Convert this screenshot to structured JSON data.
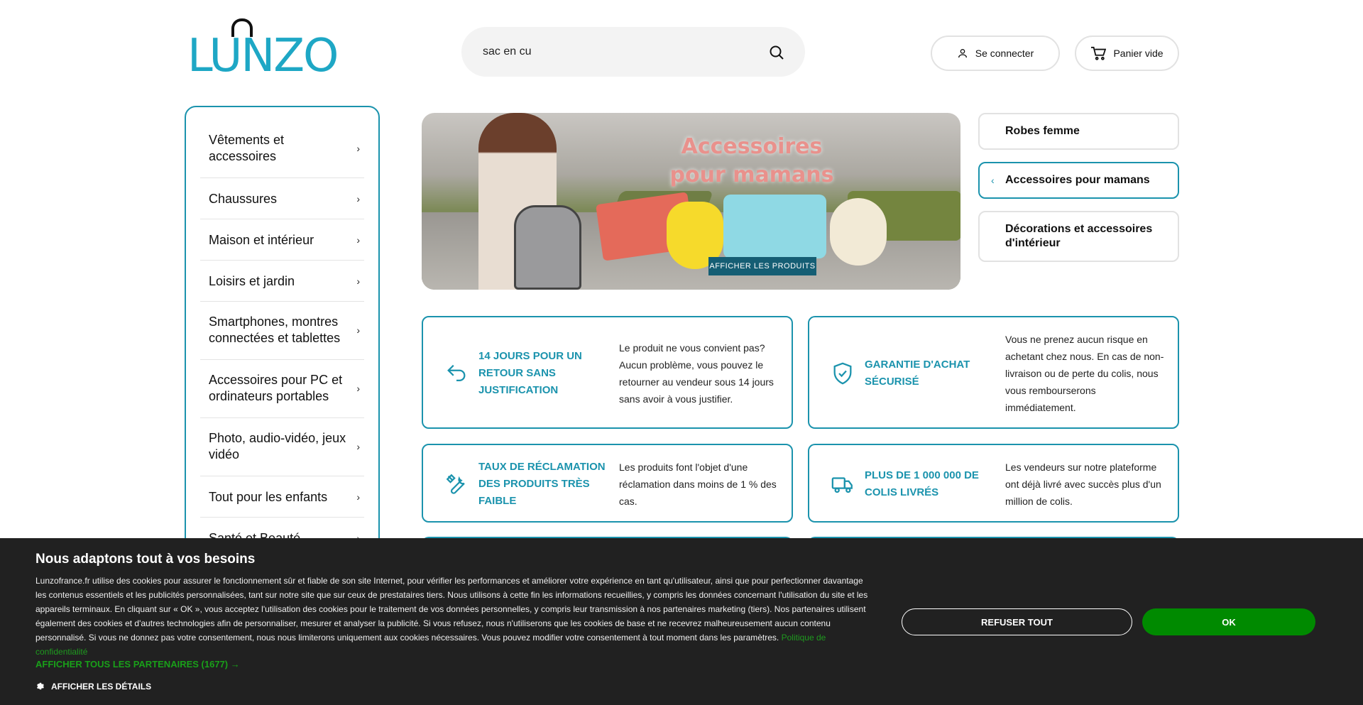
{
  "header": {
    "logo_text": "LUNZO",
    "search_value": "sac en cu",
    "login_label": "Se connecter",
    "cart_label": "Panier vide"
  },
  "sidebar": {
    "items": [
      {
        "label": "Vêtements et accessoires"
      },
      {
        "label": "Chaussures"
      },
      {
        "label": "Maison et intérieur"
      },
      {
        "label": "Loisirs et jardin"
      },
      {
        "label": "Smartphones, montres connectées et tablettes"
      },
      {
        "label": "Accessoires pour PC et ordinateurs portables"
      },
      {
        "label": "Photo, audio-vidéo, jeux vidéo"
      },
      {
        "label": "Tout pour les enfants"
      },
      {
        "label": "Santé et Beauté"
      }
    ]
  },
  "banner": {
    "title": "Accessoires pour mamans",
    "button_label": "AFFICHER LES PRODUITS"
  },
  "categories": [
    {
      "label": "Robes femme"
    },
    {
      "label": "Accessoires pour mamans",
      "active": true
    },
    {
      "label": "Décorations et accessoires d'intérieur"
    }
  ],
  "cards": [
    {
      "icon": "return-arrow-icon",
      "title": "14 JOURS POUR UN RETOUR SANS JUSTIFICATION",
      "text": "Le produit ne vous convient pas? Aucun problème, vous pouvez le retourner au vendeur sous 14 jours sans avoir à vous justifier."
    },
    {
      "icon": "shield-check-icon",
      "title": "GARANTIE D'ACHAT SÉCURISÉ",
      "text": "Vous ne prenez aucun risque en achetant chez nous. En cas de non-livraison ou de perte du colis, nous vous rembourserons immédiatement."
    },
    {
      "icon": "tools-icon",
      "title": "TAUX DE RÉCLAMATION DES PRODUITS TRÈS FAIBLE",
      "text": "Les produits font l'objet d'une réclamation dans moins de 1 % des cas."
    },
    {
      "icon": "truck-icon",
      "title": "PLUS DE 1 000 000 DE COLIS LIVRÉS",
      "text": "Les vendeurs sur notre plateforme ont déjà livré avec succès plus d'un million de colis."
    }
  ],
  "cookie": {
    "title": "Nous adaptons tout à vos besoins",
    "text": "Lunzofrance.fr utilise des cookies pour assurer le fonctionnement sûr et fiable de son site Internet, pour vérifier les performances et améliorer votre expérience en tant qu'utilisateur, ainsi que pour perfectionner davantage les contenus essentiels et les publicités personnalisées, tant sur notre site que sur ceux de prestataires tiers. Nous utilisons à cette fin les informations recueillies, y compris les données concernant l'utilisation du site et les appareils terminaux. En cliquant sur « OK », vous acceptez l'utilisation des cookies pour le traitement de vos données personnelles, y compris leur transmission à nos partenaires marketing (tiers). Nos partenaires utilisent également des cookies et d'autres technologies afin de personnaliser, mesurer et analyser la publicité. Si vous refusez, nous n'utiliserons que les cookies de base et ne recevrez malheureusement aucun contenu personnalisé. Si vous ne donnez pas votre consentement, nous nous limiterons uniquement aux cookies nécessaires. Vous pouvez modifier votre consentement à tout moment dans les paramètres.",
    "privacy_link": "Politique de confidentialité",
    "partners_link": "AFFICHER TOUS LES PARTENAIRES (1677) →",
    "details_label": "AFFICHER LES DÉTAILS",
    "refuse_label": "REFUSER TOUT",
    "ok_label": "OK"
  },
  "colors": {
    "accent": "#1b93ad",
    "ok_green": "#008a00",
    "cookie_bg": "#212121"
  }
}
